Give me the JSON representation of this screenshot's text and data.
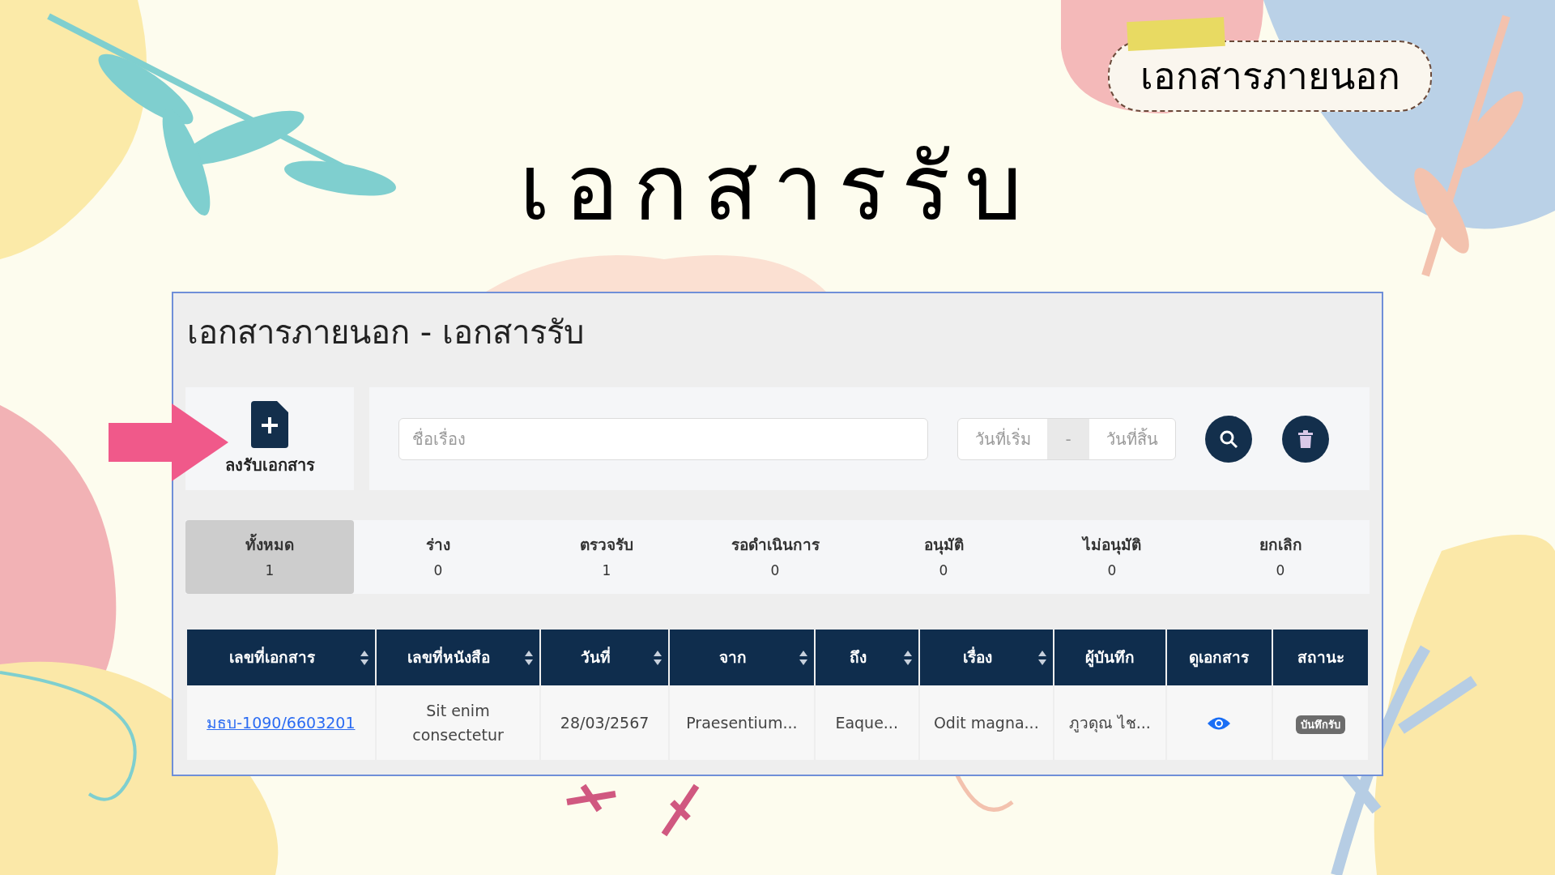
{
  "slide": {
    "title": "เอกสารรับ",
    "sticker": "เอกสารภายนอก"
  },
  "window": {
    "title": "เอกสารภายนอก - เอกสารรับ"
  },
  "add_button": {
    "label": "ลงรับเอกสาร"
  },
  "search": {
    "placeholder": "ชื่อเรื่อง",
    "date_start": "วันที่เริ่ม",
    "separator": "-",
    "date_end": "วันที่สิ้น"
  },
  "status_tabs": [
    {
      "label": "ทั้งหมด",
      "count": "1",
      "selected": true
    },
    {
      "label": "ร่าง",
      "count": "0",
      "selected": false
    },
    {
      "label": "ตรวจรับ",
      "count": "1",
      "selected": false
    },
    {
      "label": "รอดำเนินการ",
      "count": "0",
      "selected": false
    },
    {
      "label": "อนุมัติ",
      "count": "0",
      "selected": false
    },
    {
      "label": "ไม่อนุมัติ",
      "count": "0",
      "selected": false
    },
    {
      "label": "ยกเลิก",
      "count": "0",
      "selected": false
    }
  ],
  "table": {
    "columns": [
      {
        "label": "เลขที่เอกสาร",
        "sortable": true
      },
      {
        "label": "เลขที่หนังสือ",
        "sortable": true
      },
      {
        "label": "วันที่",
        "sortable": true
      },
      {
        "label": "จาก",
        "sortable": true
      },
      {
        "label": "ถึง",
        "sortable": true
      },
      {
        "label": "เรื่อง",
        "sortable": true
      },
      {
        "label": "ผู้บันทึก",
        "sortable": false
      },
      {
        "label": "ดูเอกสาร",
        "sortable": false
      },
      {
        "label": "สถานะ",
        "sortable": false
      }
    ],
    "rows": [
      {
        "cells": [
          {
            "kind": "link",
            "text": "มธบ-1090/6603201"
          },
          {
            "kind": "text",
            "text": "Sit enim consectetur"
          },
          {
            "kind": "text",
            "text": "28/03/2567"
          },
          {
            "kind": "text",
            "text": "Praesentium..."
          },
          {
            "kind": "text",
            "text": "Eaque..."
          },
          {
            "kind": "text",
            "text": "Odit magna..."
          },
          {
            "kind": "text",
            "text": "ภูวดุณ ไช..."
          },
          {
            "kind": "view"
          },
          {
            "kind": "badge",
            "text": "บันทึกรับ"
          }
        ]
      }
    ]
  }
}
